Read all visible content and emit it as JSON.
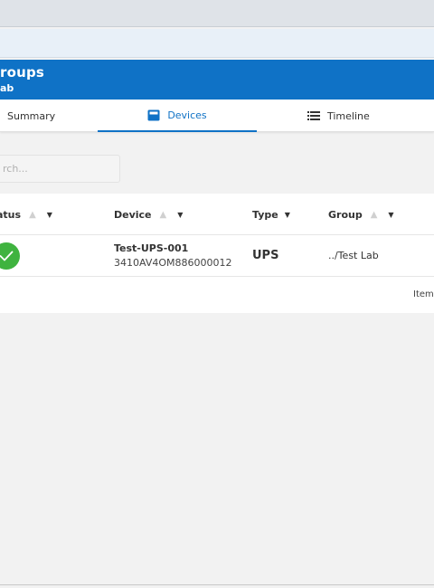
{
  "header": {
    "title": "roups",
    "subtitle": "ab"
  },
  "tabs": [
    {
      "label": "Summary",
      "active": false
    },
    {
      "label": "Devices",
      "active": true,
      "icon": "devices-icon"
    },
    {
      "label": "Timeline",
      "active": false,
      "icon": "list-icon"
    }
  ],
  "search": {
    "placeholder": "rch..."
  },
  "table": {
    "columns": [
      "atus",
      "Device",
      "Type",
      "Group"
    ],
    "rows": [
      {
        "status": "ok",
        "name": "Test-UPS-001",
        "serial": "3410AV4OM886000012",
        "type": "UPS",
        "group": "../Test Lab"
      }
    ],
    "footer_label": "Item"
  },
  "colors": {
    "accent": "#0f72c6",
    "status_ok": "#3fb33f"
  }
}
